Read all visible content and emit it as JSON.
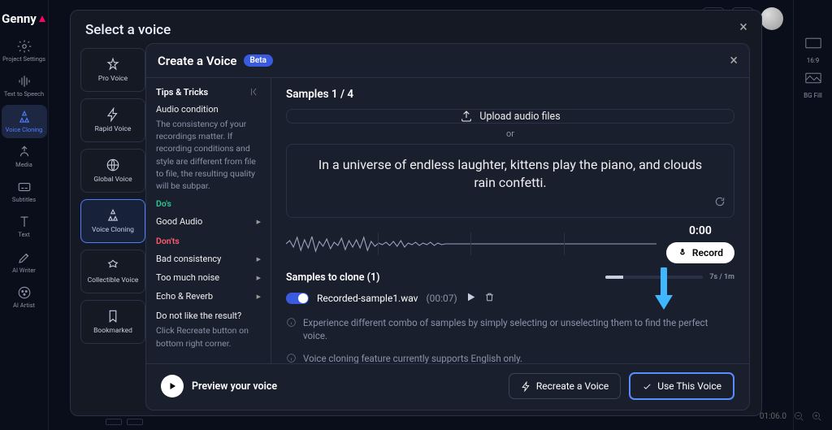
{
  "brand": "Genny",
  "leftRail": [
    {
      "id": "project-settings",
      "label": "Project Settings"
    },
    {
      "id": "tts",
      "label": "Text to Speech"
    },
    {
      "id": "voice-cloning",
      "label": "Voice Cloning"
    },
    {
      "id": "media",
      "label": "Media"
    },
    {
      "id": "subtitles",
      "label": "Subtitles"
    },
    {
      "id": "text",
      "label": "Text"
    },
    {
      "id": "ai-writer",
      "label": "AI Writer"
    },
    {
      "id": "ai-artist",
      "label": "AI Artist"
    }
  ],
  "rightRail": {
    "ratio": "16:9",
    "bg": "BG Fill"
  },
  "bottomInfo": {
    "time": "01:06.0"
  },
  "outerModal": {
    "title": "Select a voice"
  },
  "voiceCats": [
    {
      "id": "pro",
      "label": "Pro Voice"
    },
    {
      "id": "rapid",
      "label": "Rapid Voice"
    },
    {
      "id": "global",
      "label": "Global Voice"
    },
    {
      "id": "cloning",
      "label": "Voice Cloning"
    },
    {
      "id": "collect",
      "label": "Collectible Voice"
    },
    {
      "id": "bookmark",
      "label": "Bookmarked"
    }
  ],
  "createPanel": {
    "title": "Create a Voice",
    "beta": "Beta",
    "tips": {
      "title": "Tips & Tricks",
      "conditionTitle": "Audio condition",
      "conditionBody": "The consistency of your recordings matter. If recording conditions and style are different from file to file, the resulting quality will be subpar.",
      "dosLabel": "Do's",
      "good": "Good Audio",
      "dontsLabel": "Don'ts",
      "bad": [
        "Bad consistency",
        "Too much noise",
        "Echo & Reverb"
      ],
      "notLike": "Do not like the result?",
      "recreate": "Click Recreate button on bottom right corner."
    },
    "samples": {
      "countLabel": "Samples 1 / 4",
      "upload": "Upload audio files",
      "or": "or",
      "readText": "In a universe of endless laughter, kittens play the piano, and clouds rain confetti.",
      "timer": "0:00",
      "record": "Record",
      "cloneLabel": "Samples to clone (1)",
      "progress": "7s / 1m",
      "sampleName": "Recorded-sample1.wav",
      "sampleDur": "(00:07)",
      "warn1": "Experience different combo of samples by simply selecting or unselecting them to find the perfect voice.",
      "warn2": "Voice cloning feature currently supports English only."
    },
    "footer": {
      "preview": "Preview your voice",
      "recreate": "Recreate a Voice",
      "use": "Use This Voice"
    }
  }
}
